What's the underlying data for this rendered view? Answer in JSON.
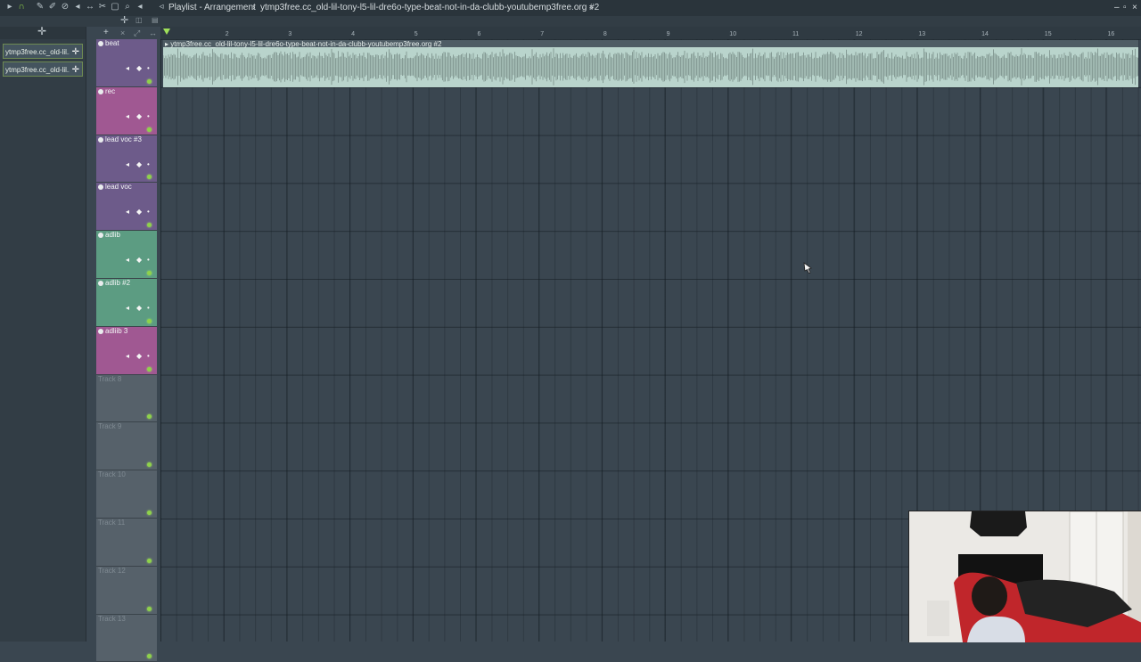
{
  "titlebar": {
    "window_title": "Playlist - Arrangement",
    "separator": "›",
    "clip_name": "ytmp3free.cc_old-lil-tony-l5-lil-dre6o-type-beat-not-in-da-clubb-youtubemp3free.org #2",
    "end_arrow": "›",
    "window_controls": [
      "–",
      "▫",
      "×"
    ]
  },
  "picker": {
    "clips": [
      "ytmp3free.cc_old-lil...",
      "ytmp3free.cc_old-lil..."
    ]
  },
  "ruler": {
    "bars": [
      "2",
      "3",
      "4",
      "5",
      "6",
      "7",
      "8",
      "9",
      "10",
      "11",
      "12",
      "13",
      "14",
      "15",
      "16"
    ]
  },
  "clip": {
    "label": "ytmp3free.cc_old-lil-tony-l5-lil-dre6o-type-beat-not-in-da-clubb-youtubemp3free.org #2"
  },
  "tracks": [
    {
      "name": "beat",
      "color": "#6d5b8a"
    },
    {
      "name": "rec",
      "color": "#a05892"
    },
    {
      "name": "lead voc #3",
      "color": "#6d5b8a"
    },
    {
      "name": "lead voc",
      "color": "#6d5b8a"
    },
    {
      "name": "adlib",
      "color": "#5c9c82"
    },
    {
      "name": "adlib #2",
      "color": "#5c9c82"
    },
    {
      "name": "adliib 3",
      "color": "#a05892"
    },
    {
      "name": "Track 8",
      "color": "#56616a"
    },
    {
      "name": "Track 9",
      "color": "#56616a"
    },
    {
      "name": "Track 10",
      "color": "#56616a"
    },
    {
      "name": "Track 11",
      "color": "#56616a"
    },
    {
      "name": "Track 12",
      "color": "#56616a"
    },
    {
      "name": "Track 13",
      "color": "#56616a"
    }
  ],
  "colors": {
    "accent_green": "#8fd24a",
    "waveform_bg": "#b9d4cc",
    "grid_bg": "#3a4650"
  }
}
